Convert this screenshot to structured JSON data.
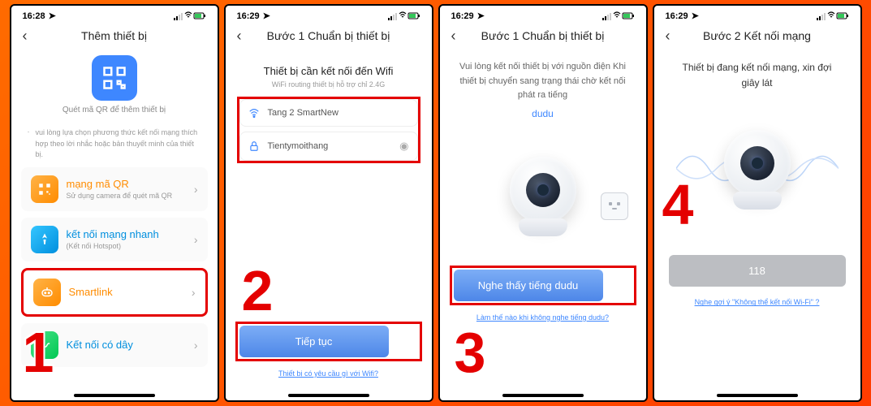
{
  "status": {
    "time1": "16:28",
    "time2": "16:29",
    "time3": "16:29",
    "time4": "16:29"
  },
  "s1": {
    "title": "Thêm thiết bị",
    "qr_caption": "Quét mã QR để thêm thiết bị",
    "hint": "vui lòng lựa chọn phương thức kết nối mạng thích hợp theo lời nhắc hoặc bản thuyết minh của thiết bị.",
    "items": [
      {
        "title": "mạng mã QR",
        "sub": "Sử dụng camera để quét mã QR"
      },
      {
        "title": "kết nối mạng nhanh",
        "sub": "(Kết nối Hotspot)"
      },
      {
        "title": "Smartlink",
        "sub": ""
      },
      {
        "title": "Kết nối có dây",
        "sub": ""
      }
    ]
  },
  "s2": {
    "title": "Bước 1 Chuẩn bị thiết bị",
    "heading": "Thiết bị cần kết nối đến Wifi",
    "sub": "WiFi routing thiết bị hỗ trợ chỉ 2.4G",
    "ssid": "Tang 2 SmartNew",
    "pwd": "Tientymoithang",
    "btn": "Tiếp tục",
    "link": "Thiết bị có yêu cầu gì với Wifi?"
  },
  "s3": {
    "title": "Bước 1 Chuẩn bị thiết bị",
    "body": "Vui lòng kết nối thiết bị với nguồn điện Khi thiết bị chuyển sang trạng thái chờ kết nối phát ra tiếng",
    "dudu": "dudu",
    "btn": "Nghe thấy tiếng dudu",
    "link": "Làm thế nào khi không nghe tiếng dudu?"
  },
  "s4": {
    "title": "Bước 2 Kết nối mạng",
    "body": "Thiết bị đang kết nối mạng, xin đợi giây lát",
    "progress": "118",
    "link": "Nghe gợi ý \"Không thể kết nối Wi-Fi\" ?"
  },
  "nums": {
    "n1": "1",
    "n2": "2",
    "n3": "3",
    "n4": "4"
  }
}
